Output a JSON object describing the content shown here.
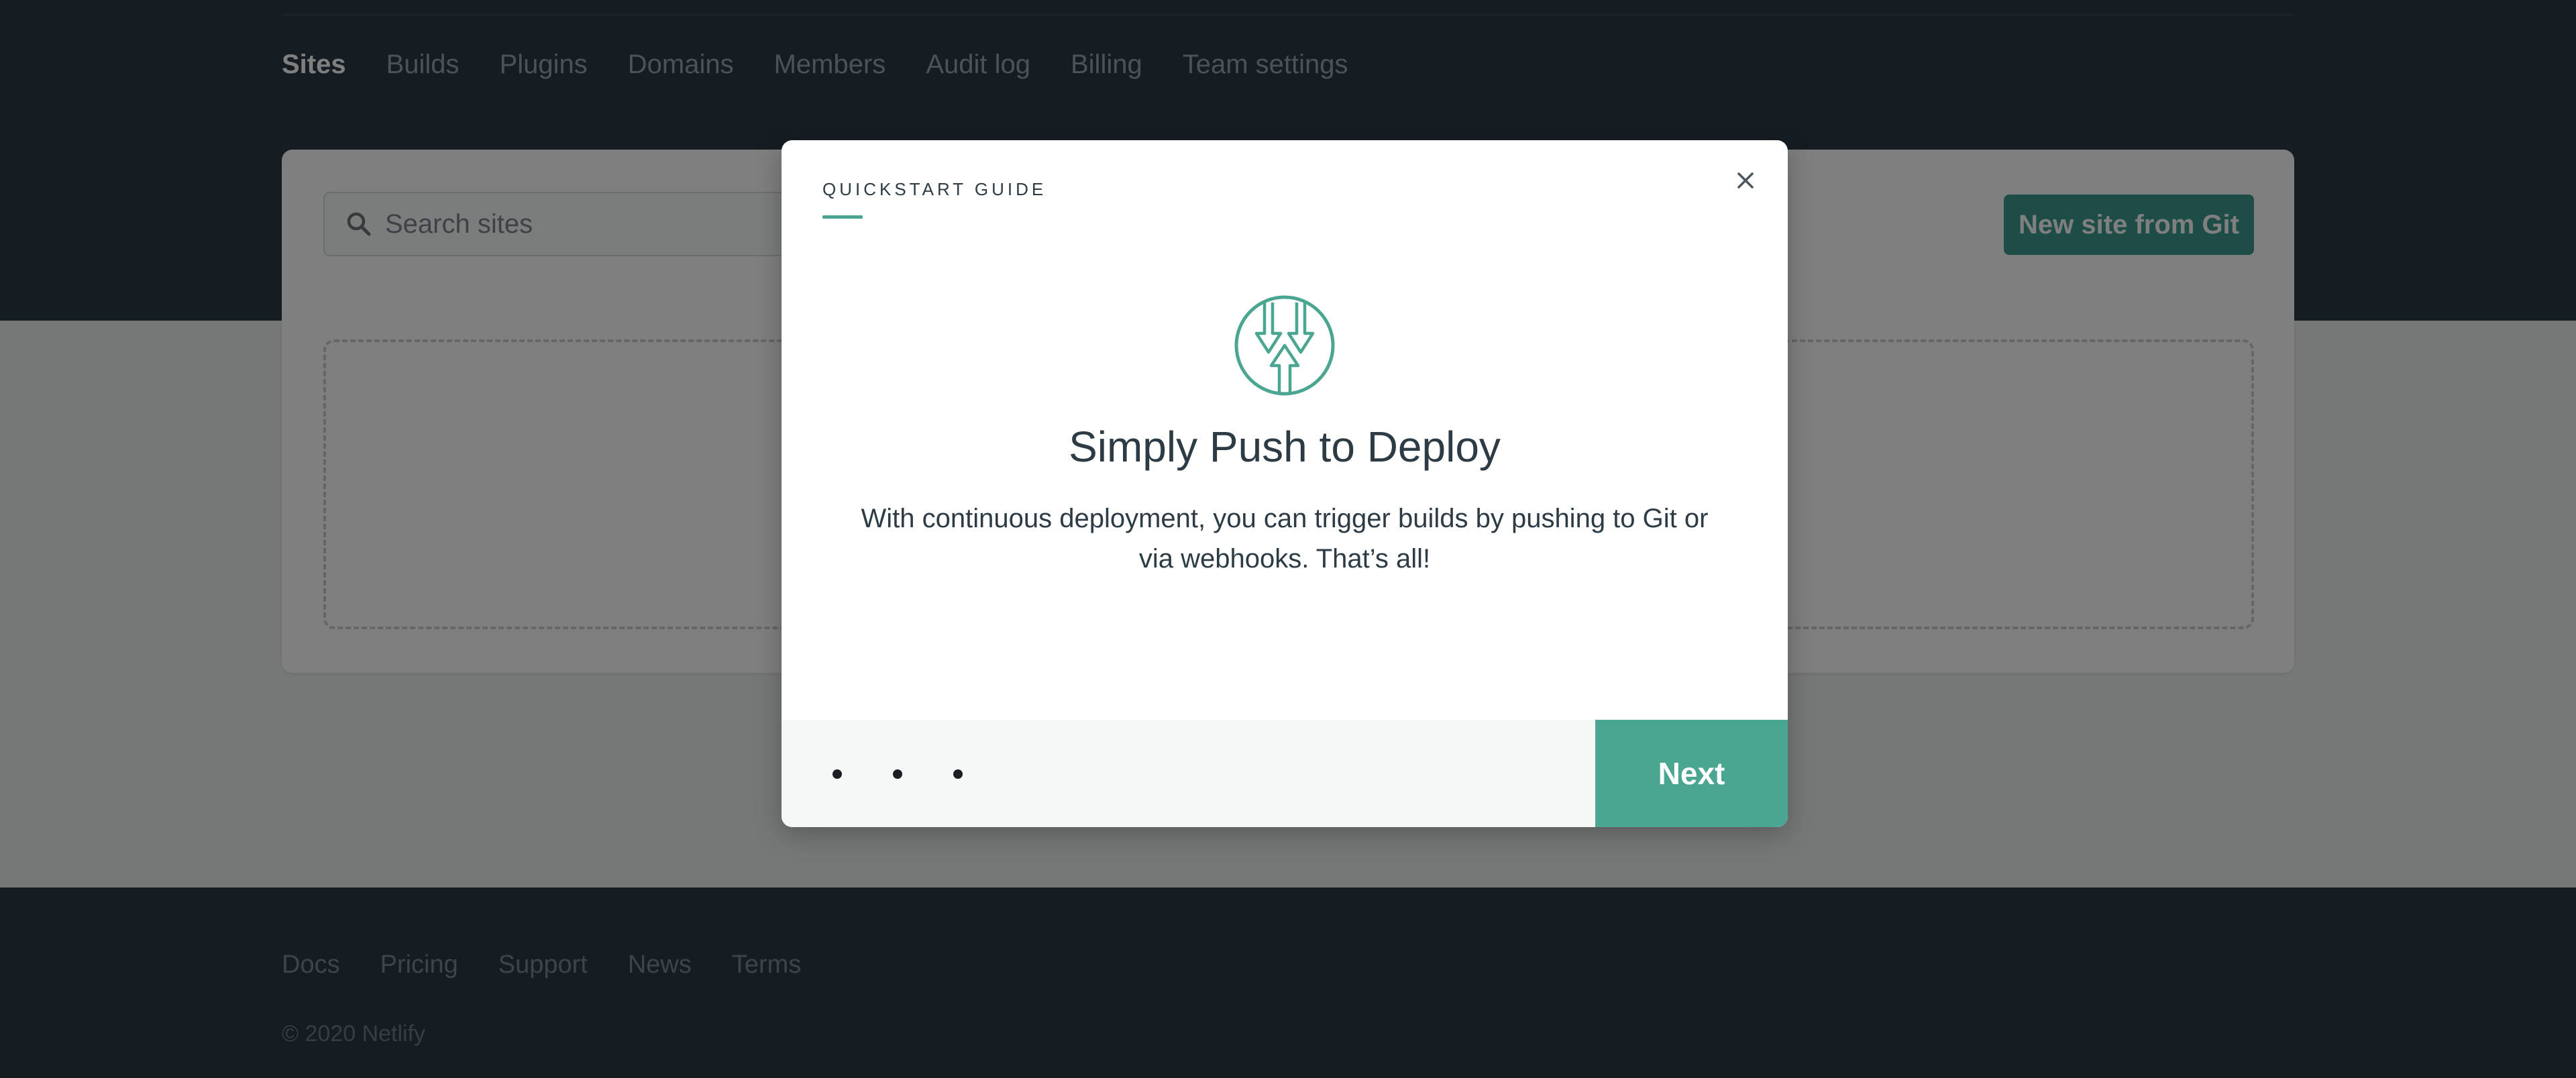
{
  "team_nav": {
    "items": [
      {
        "label": "Sites",
        "active": true
      },
      {
        "label": "Builds"
      },
      {
        "label": "Plugins"
      },
      {
        "label": "Domains"
      },
      {
        "label": "Members"
      },
      {
        "label": "Audit log"
      },
      {
        "label": "Billing"
      },
      {
        "label": "Team settings"
      }
    ]
  },
  "sites": {
    "search_placeholder": "Search sites",
    "new_site_label": "New site from Git"
  },
  "modal": {
    "kicker": "QUICKSTART GUIDE",
    "title": "Simply Push to Deploy",
    "body": "With continuous deployment, you can trigger builds by pushing to Git or via webhooks. That’s all!",
    "next_label": "Next",
    "step_count": 3,
    "icon": "push-deploy-icon",
    "close_icon": "close-icon"
  },
  "footer": {
    "links": [
      "Docs",
      "Pricing",
      "Support",
      "News",
      "Terms"
    ],
    "copyright": "© 2020 Netlify"
  },
  "colors": {
    "header_bg": "#2d3b45",
    "accent": "#4aa691",
    "page_bg": "#edf0f0"
  }
}
